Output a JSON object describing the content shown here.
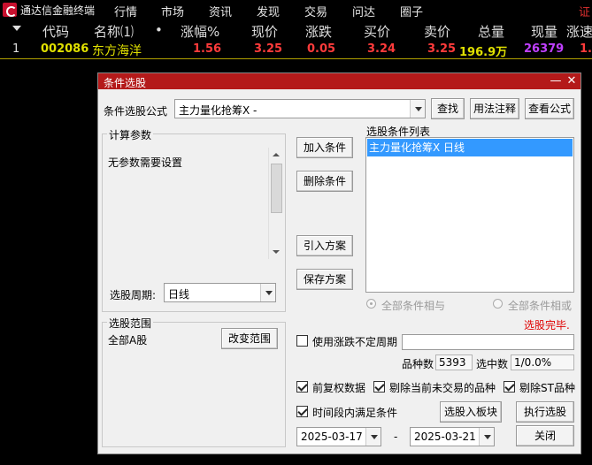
{
  "app": {
    "name": "通达信金融终端",
    "menus": [
      "行情",
      "市场",
      "资讯",
      "发现",
      "交易",
      "问达",
      "圈子"
    ],
    "right_text": "证"
  },
  "quote_table": {
    "headers": [
      "代码",
      "名称⑴",
      "•",
      "涨幅%",
      "现价",
      "涨跌",
      "买价",
      "卖价",
      "总量",
      "现量",
      "涨速"
    ],
    "rows": [
      {
        "index": "1",
        "code": "002086",
        "name": "东方海洋",
        "change_pct": "1.56",
        "price": "3.25",
        "change": "0.05",
        "bid": "3.24",
        "ask": "3.25",
        "volume": "196.9万",
        "last_vol": "26379",
        "speed": "1."
      }
    ]
  },
  "dialog": {
    "title": "条件选股",
    "formula_label": "条件选股公式",
    "formula_value": "主力量化抢筹X -",
    "find_button": "查找",
    "usage_button": "用法注释",
    "view_formula_button": "查看公式",
    "params_group_title": "计算参数",
    "params_text": "无参数需要设置",
    "period_label": "选股周期:",
    "period_value": "日线",
    "add_condition_button": "加入条件",
    "delete_condition_button": "删除条件",
    "import_plan_button": "引入方案",
    "save_plan_button": "保存方案",
    "condition_list_label": "选股条件列表",
    "condition_items": [
      "主力量化抢筹X  日线"
    ],
    "radio_and_label": "全部条件相与",
    "radio_or_label": "全部条件相或",
    "status_text": "选股完毕.",
    "range_group_title": "选股范围",
    "range_value": "全部A股",
    "change_range_button": "改变范围",
    "use_unfixed_period_label": "使用涨跌不定周期",
    "count_label": "品种数",
    "count_value": "5393",
    "selected_label": "选中数",
    "selected_value": "1/0.0%",
    "forward_adjust_label": "前复权数据",
    "exclude_untraded_label": "剔除当前未交易的品种",
    "exclude_st_label": "剔除ST品种",
    "time_range_label": "时间段内满足条件",
    "to_board_button": "选股入板块",
    "execute_button": "执行选股",
    "start_date": "2025-03-17",
    "date_separator": "-",
    "end_date": "2025-03-21",
    "close_button": "关闭"
  },
  "colors": {
    "up": "#ff3b3b",
    "code": "#e0e000",
    "name": "#e0e000",
    "volume": "#e0e000",
    "last_vol": "#c040ff",
    "status": "#e00000",
    "titlebar": "#b41a1a"
  }
}
